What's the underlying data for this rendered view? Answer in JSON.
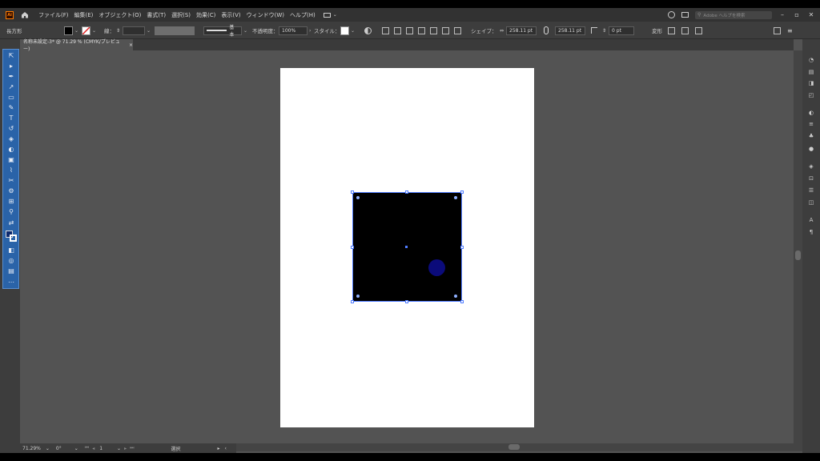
{
  "menubar": {
    "logo": "Ai",
    "items": [
      "ファイル(F)",
      "編集(E)",
      "オブジェクト(O)",
      "書式(T)",
      "選択(S)",
      "効果(C)",
      "表示(V)",
      "ウィンドウ(W)",
      "ヘルプ(H)"
    ],
    "search_placeholder": "Adobe ヘルプを検索"
  },
  "control_bar": {
    "object_type": "長方形",
    "stroke_label": "線：",
    "stroke_style": "基本",
    "opacity_label": "不透明度：",
    "opacity_value": "100%",
    "style_label": "スタイル：",
    "shape_label": "シェイプ：",
    "width_value": "258.11 pt",
    "height_value": "258.11 pt",
    "corner_value": "0 pt",
    "transform_label": "変形"
  },
  "document_tab": {
    "title": "名称未設定-3* @ 71.29 % (CMYK/プレビュー)",
    "close": "×"
  },
  "status_bar": {
    "zoom": "71.29%",
    "rotation": "0°",
    "artboard_number": "1",
    "mode": "選択"
  },
  "colors": {
    "toolbar_accent": "#2a63a8",
    "selection": "#4f7cff",
    "circle_fill": "#0b0b7a",
    "rect_fill": "#000000"
  }
}
